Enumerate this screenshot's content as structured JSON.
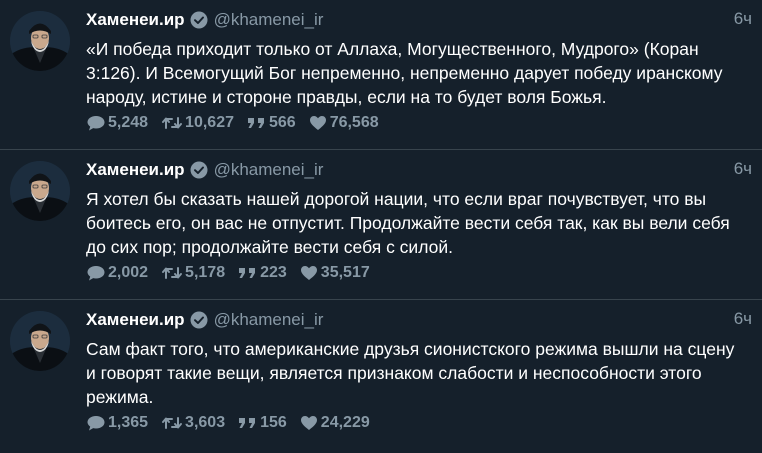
{
  "tweets": [
    {
      "author": "Хаменеи.ир",
      "handle": "@khamenei_ir",
      "time": "6ч",
      "text": "«И победа приходит только от Аллаха, Могущественного, Мудрого» (Коран 3:126). И Всемогущий Бог непременно, непременно дарует победу иранскому народу, истине и стороне правды, если на то будет воля Божья.",
      "replies": "5,248",
      "retweets": "10,627",
      "quotes": "566",
      "likes": "76,568"
    },
    {
      "author": "Хаменеи.ир",
      "handle": "@khamenei_ir",
      "time": "6ч",
      "text": "Я хотел бы сказать нашей дорогой нации, что если враг почувствует, что вы боитесь его, он вас не отпустит. Продолжайте вести себя так, как вы вели себя до сих пор; продолжайте вести себя с силой.",
      "replies": "2,002",
      "retweets": "5,178",
      "quotes": "223",
      "likes": "35,517"
    },
    {
      "author": "Хаменеи.ир",
      "handle": "@khamenei_ir",
      "time": "6ч",
      "text": "Сам факт того, что американские друзья сионистского режима вышли на сцену и говорят такие вещи, является признаком слабости и неспособности этого режима.",
      "replies": "1,365",
      "retweets": "3,603",
      "quotes": "156",
      "likes": "24,229"
    }
  ],
  "icons": {
    "avatar": "avatar-portrait",
    "verified": "verified-badge-icon",
    "reply": "reply-bubble-icon",
    "retweet": "retweet-icon",
    "quote": "quote-icon",
    "like": "heart-icon"
  },
  "colors": {
    "background": "#15202b",
    "divider": "#38444d",
    "muted": "#8899a6",
    "text": "#ffffff",
    "verified_badge": "#8899a6"
  }
}
